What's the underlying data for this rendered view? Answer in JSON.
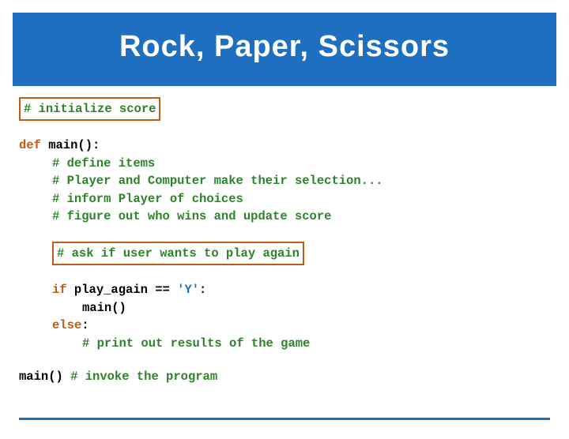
{
  "title": "Rock, Paper, Scissors",
  "code": {
    "init_comment": "# initialize score",
    "def_kw": "def",
    "main_sig": " main():",
    "c_define": "# define items",
    "c_player": "# Player and Computer make their selection...",
    "c_inform": "# inform Player of choices",
    "c_figure": "# figure out who wins and update score",
    "c_ask": "# ask if user wants to play again",
    "if_kw": "if",
    "if_cond": " play_again == ",
    "if_str": "'Y'",
    "colon": ":",
    "main_call": "main()",
    "else_kw": "else",
    "c_print": "# print out results of the game",
    "main_bottom": "main() ",
    "c_invoke": "# invoke the program"
  }
}
